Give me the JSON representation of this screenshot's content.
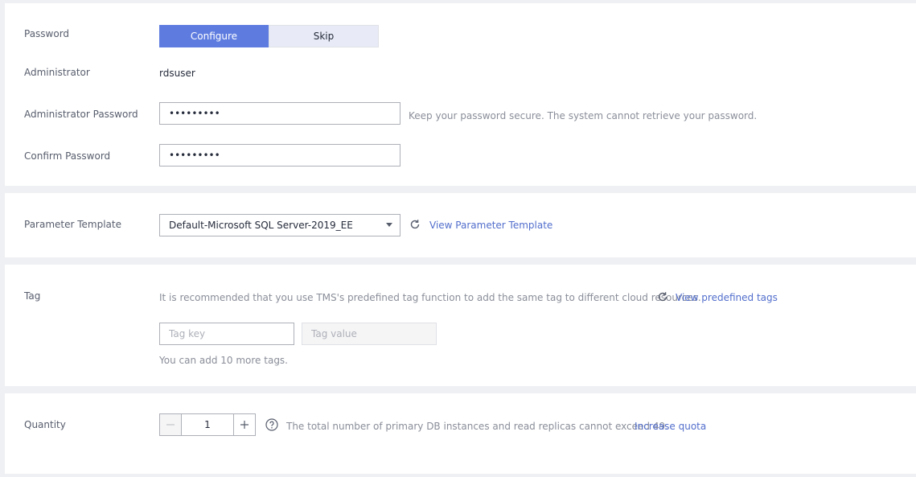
{
  "password_section": {
    "label": "Password",
    "configure_label": "Configure",
    "skip_label": "Skip",
    "administrator_label": "Administrator",
    "administrator_value": "rdsuser",
    "admin_password_label": "Administrator Password",
    "admin_password_value": "•••••••••",
    "admin_password_hint": "Keep your password secure. The system cannot retrieve your password.",
    "confirm_password_label": "Confirm Password",
    "confirm_password_value": "•••••••••"
  },
  "parameter_section": {
    "label": "Parameter Template",
    "selected_value": "Default-Microsoft SQL Server-2019_EE",
    "view_link": "View Parameter Template"
  },
  "tag_section": {
    "label": "Tag",
    "description": "It is recommended that you use TMS's predefined tag function to add the same tag to different cloud resources.",
    "view_link": "View predefined tags",
    "key_placeholder": "Tag key",
    "value_placeholder": "Tag value",
    "remaining_text": "You can add 10 more tags."
  },
  "quantity_section": {
    "label": "Quantity",
    "value": "1",
    "hint": "The total number of primary DB instances and read replicas cannot exceed 49.",
    "quota_link": "Increase quota"
  },
  "colors": {
    "accent": "#5e7ce0",
    "link": "#526ecc",
    "page_bg": "#eff0f3"
  }
}
